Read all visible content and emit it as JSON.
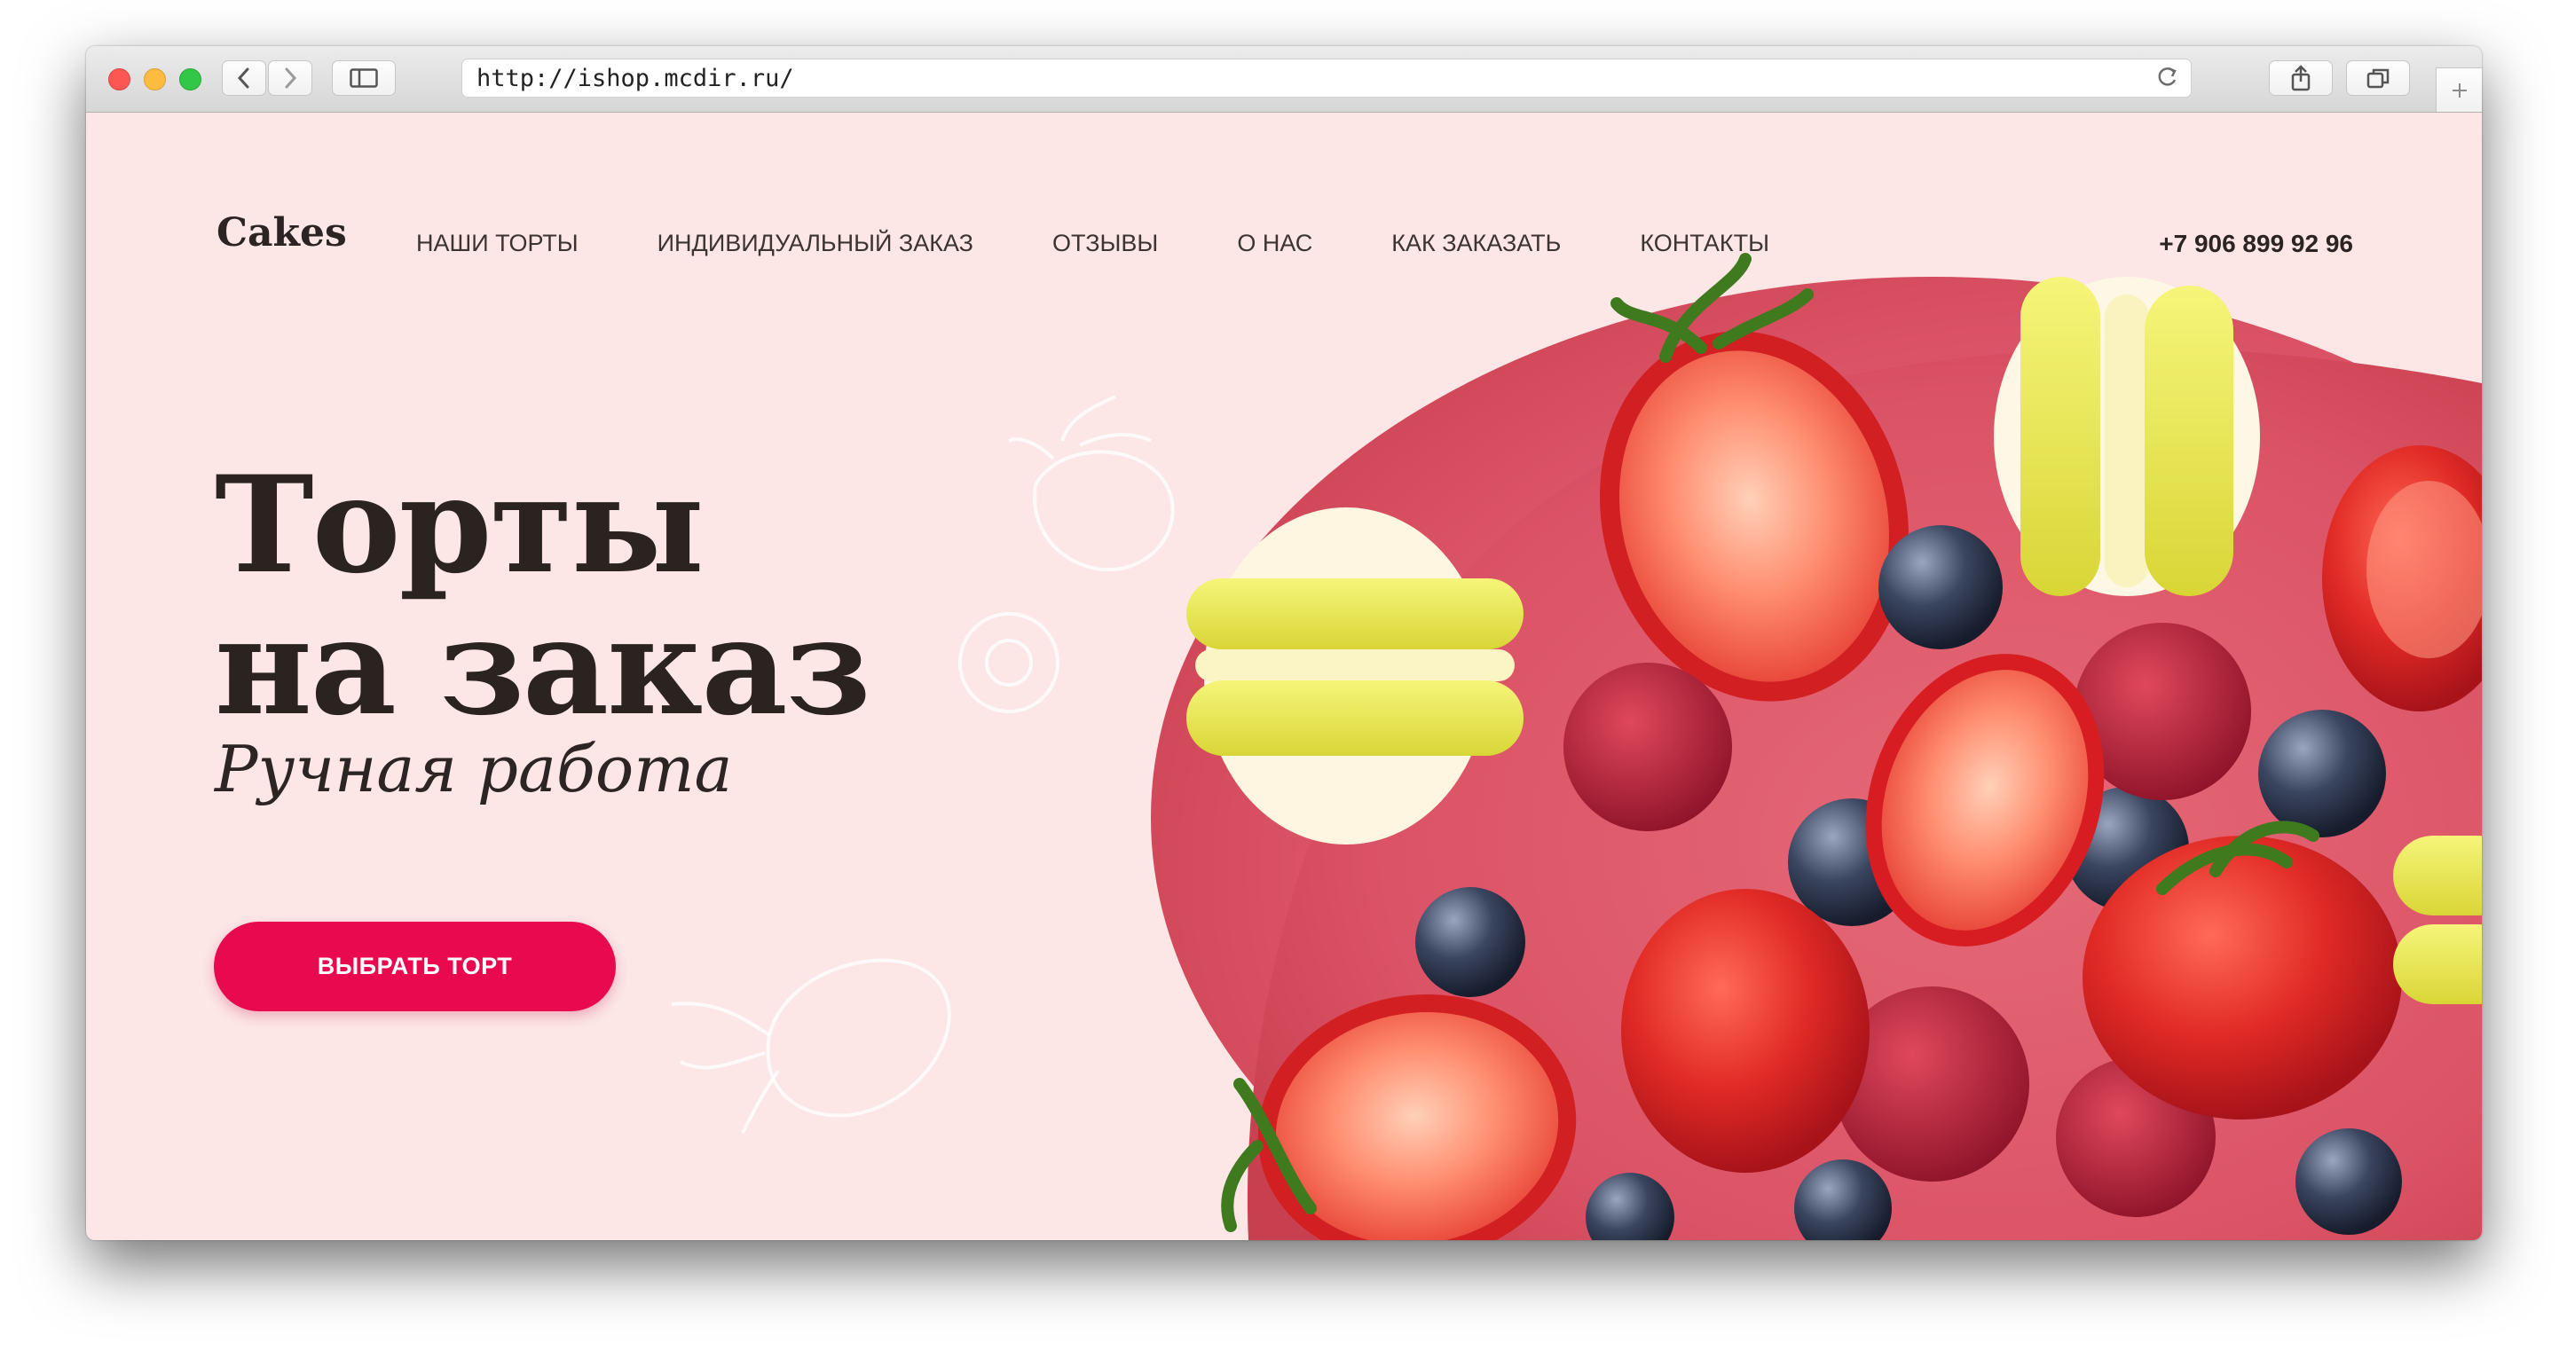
{
  "browser": {
    "url": "http://ishop.mcdir.ru/",
    "back_icon": "chevron-left-icon",
    "forward_icon": "chevron-right-icon",
    "sidebar_icon": "sidebar-icon",
    "reload_icon": "reload-icon",
    "share_icon": "share-icon",
    "tabs_icon": "tabs-icon",
    "new_tab_icon": "plus-icon"
  },
  "site": {
    "logo": "Cakes",
    "nav": [
      "НАШИ ТОРТЫ",
      "ИНДИВИДУАЛЬНЫЙ ЗАКАЗ",
      "ОТЗЫВЫ",
      "О НАС",
      "КАК ЗАКАЗАТЬ",
      "КОНТАКТЫ"
    ],
    "phone": "+7 906 899 92 96"
  },
  "hero": {
    "title_line1": "Торты",
    "title_line2": "на заказ",
    "subtitle": "Ручная работа",
    "cta_label": "ВЫБРАТЬ ТОРТ"
  },
  "colors": {
    "background": "#fce6e6",
    "accent": "#e8094f",
    "text": "#2a2320"
  }
}
